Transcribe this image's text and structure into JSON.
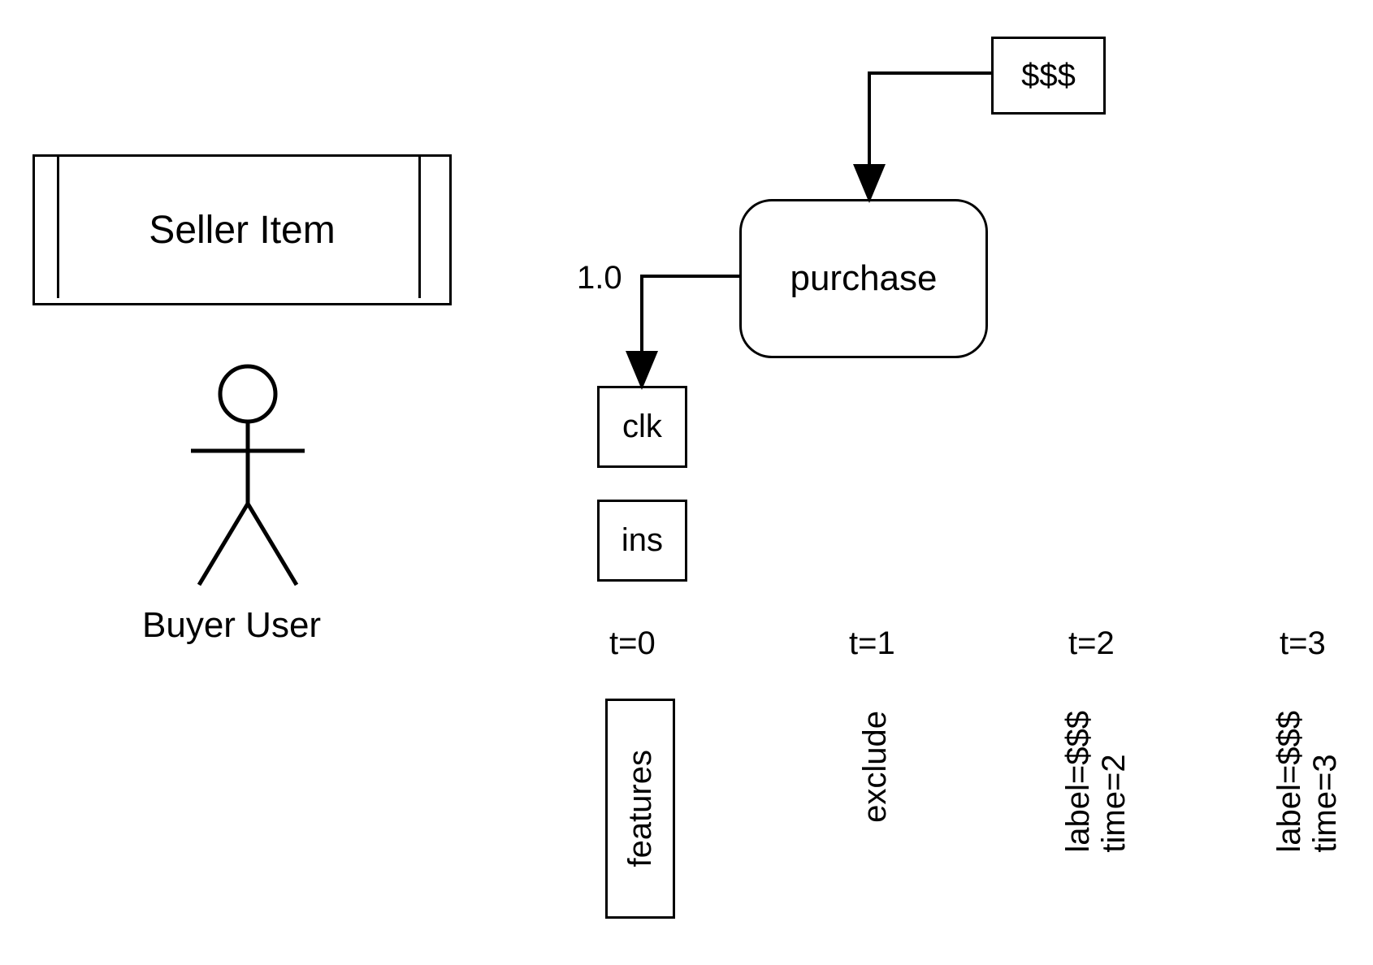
{
  "seller_item_label": "Seller Item",
  "buyer_user_label": "Buyer User",
  "money_box": "$$$",
  "purchase_box": "purchase",
  "clk_box": "clk",
  "ins_box": "ins",
  "edge_weight": "1.0",
  "timesteps": {
    "t0": {
      "label": "t=0",
      "col_label": "features"
    },
    "t1": {
      "label": "t=1",
      "col_label": "exclude"
    },
    "t2": {
      "label": "t=2",
      "col_label_line1": "label=$$$",
      "col_label_line2": "time=2"
    },
    "t3": {
      "label": "t=3",
      "col_label_line1": "label=$$$",
      "col_label_line2": "time=3"
    }
  }
}
